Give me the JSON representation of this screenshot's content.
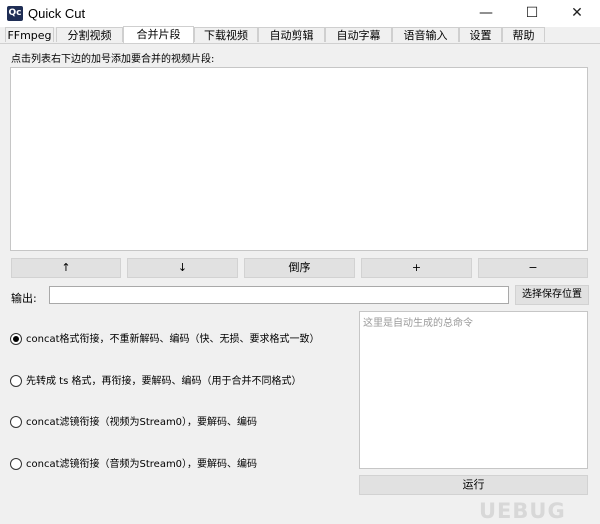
{
  "window": {
    "icon_text": "Qc",
    "title": "Quick Cut",
    "minimize_glyph": "—",
    "maximize_glyph": "☐",
    "close_glyph": "✕"
  },
  "tabs": [
    {
      "label": "FFmpeg"
    },
    {
      "label": "分割视频"
    },
    {
      "label": "合并片段",
      "active": true
    },
    {
      "label": "下载视频"
    },
    {
      "label": "自动剪辑"
    },
    {
      "label": "自动字幕"
    },
    {
      "label": "语音输入"
    },
    {
      "label": "设置"
    },
    {
      "label": "帮助"
    }
  ],
  "merge": {
    "hint": "点击列表右下边的加号添加要合并的视频片段:",
    "buttons": {
      "up": "↑",
      "down": "↓",
      "reverse": "倒序",
      "add": "+",
      "remove": "−"
    },
    "output_label": "输出:",
    "output_value": "",
    "save_location_button": "选择保存位置",
    "options": [
      {
        "label": "concat格式衔接，不重新解码、编码（快、无损、要求格式一致）",
        "checked": true
      },
      {
        "label": "先转成 ts 格式，再衔接，要解码、编码（用于合并不同格式）",
        "checked": false
      },
      {
        "label": "concat滤镜衔接（视频为Stream0），要解码、编码",
        "checked": false
      },
      {
        "label": "concat滤镜衔接（音频为Stream0），要解码、编码",
        "checked": false
      }
    ],
    "command_placeholder": "这里是自动生成的总命令",
    "run_button": "运行"
  },
  "watermark": "UEBUG"
}
